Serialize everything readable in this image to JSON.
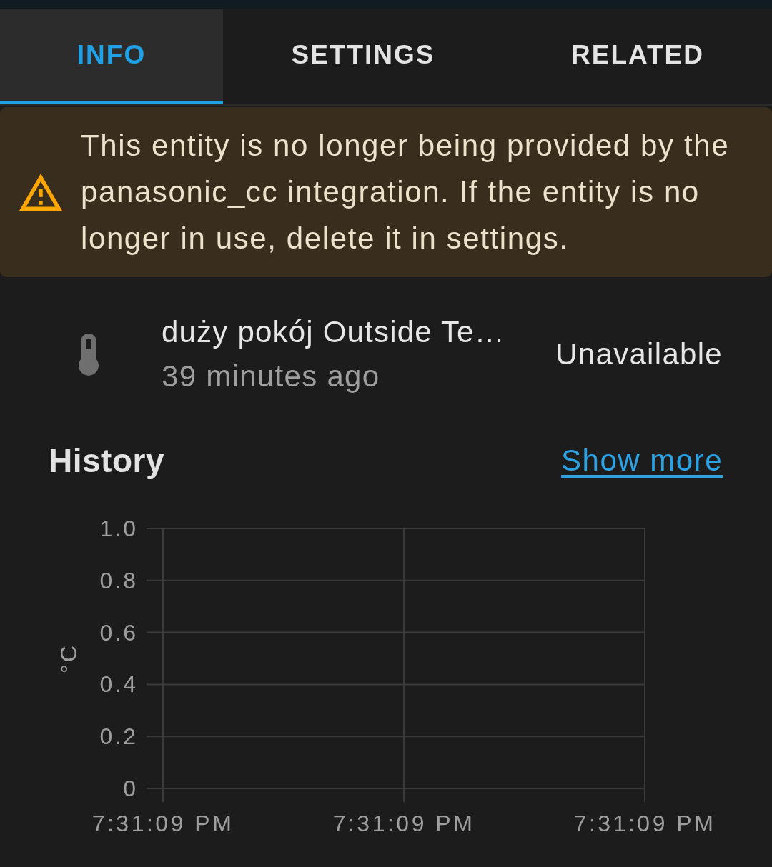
{
  "tabs": [
    {
      "label": "INFO",
      "selected": true
    },
    {
      "label": "SETTINGS",
      "selected": false
    },
    {
      "label": "RELATED",
      "selected": false
    }
  ],
  "warning": {
    "text": "This entity is no longer being provided by the panasonic_cc integration. If the entity is no longer in use, delete it in settings."
  },
  "entity": {
    "name": "duży pokój Outside Te…",
    "last_changed": "39 minutes ago",
    "state": "Unavailable"
  },
  "history": {
    "title": "History",
    "link": "Show more",
    "chart_data": {
      "type": "line",
      "ylabel": "°C",
      "ylim": [
        0,
        1
      ],
      "yticks": [
        0,
        0.2,
        0.4,
        0.6,
        0.8,
        {
          "value": 1,
          "label": "1.0"
        }
      ],
      "categories": [
        "7:31:09 PM",
        "7:31:09 PM",
        "7:31:09 PM"
      ],
      "grid": true
    }
  }
}
